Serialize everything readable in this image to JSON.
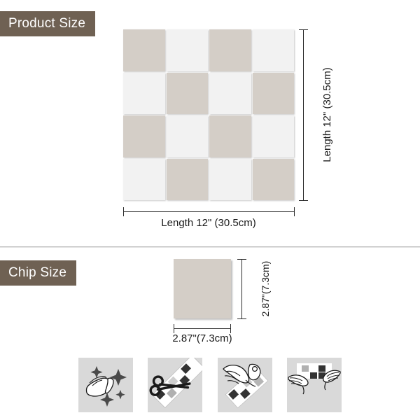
{
  "sections": {
    "product": {
      "badge_label": "Product Size",
      "width_label": "Length 12\" (30.5cm)",
      "height_label": "Length 12\" (30.5cm)"
    },
    "chip": {
      "badge_label": "Chip Size",
      "width_label": "2.87\"(7.3cm)",
      "height_label": "2.87\"(7.3cm)"
    }
  },
  "tile_grid": {
    "rows": 4,
    "columns": 4,
    "pattern": [
      [
        "beige",
        "white",
        "beige",
        "white"
      ],
      [
        "white",
        "beige",
        "white",
        "beige"
      ],
      [
        "beige",
        "white",
        "beige",
        "white"
      ],
      [
        "white",
        "beige",
        "white",
        "beige"
      ]
    ]
  },
  "colors": {
    "badge_background": "#6f6153",
    "tile_beige": "#d4cec7",
    "tile_white": "#f2f2f2",
    "step_background": "#d9d9d9",
    "divider": "#b9b9b9",
    "dimension_line": "#2b2b2b"
  },
  "steps": [
    {
      "icon": "hand-wiping-cloth-sparkles-icon",
      "order": "1"
    },
    {
      "icon": "scissors-cutting-tile-strip-icon",
      "order": "2"
    },
    {
      "icon": "hands-peeling-backing-icon",
      "order": "3"
    },
    {
      "icon": "hands-pressing-tile-to-wall-icon",
      "order": "4"
    }
  ]
}
